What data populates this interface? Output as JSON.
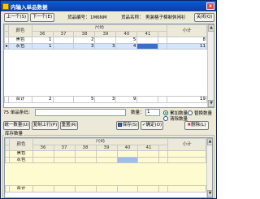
{
  "window": {
    "title": "内输入单品数据",
    "close_label": "x"
  },
  "toolbar": {
    "prev_label": "上一个(S)",
    "next_label": "下一个(E)",
    "product_code_label": "货品编号：",
    "product_code_value": "1M6NM",
    "product_name_label": "货品名称：",
    "product_name_value": "男装格子棉制休闲衫",
    "close_label": "关闭(Q)"
  },
  "top_grid": {
    "header_color": "颜色",
    "header_size_group": "尺码",
    "header_subtotal": "小计",
    "sizes": [
      "36",
      "37",
      "38",
      "39",
      "40",
      "41"
    ],
    "rows": [
      {
        "color": "黑色",
        "values": [
          "1",
          "",
          "2",
          "",
          "5",
          ""
        ],
        "subtotal": "8"
      },
      {
        "color": "灰色",
        "values": [
          "1",
          "",
          "3",
          "3",
          "4",
          ""
        ],
        "subtotal": "11"
      }
    ],
    "total_label": "合计",
    "totals": [
      "2",
      "",
      "5",
      "3",
      "9",
      ""
    ],
    "total_subtotal": "19"
  },
  "input_row": {
    "barcode_label": "75 单品条码：",
    "barcode_value": "",
    "qty_label": "数量：",
    "qty_value": "1",
    "mode_add": "累加数量",
    "mode_replace": "替换数量",
    "mode_clear": "清除数量",
    "mode_selected": "mode_add"
  },
  "actions": {
    "uniform_label": "统一数量(U)",
    "copy_label": "复制上行(P)",
    "reset_label": "重置(R)",
    "save_label": "保存(S)",
    "ok_label": "确定(O)",
    "delete_label": "删除(L)"
  },
  "bottom_group": {
    "title": "库存数量",
    "header_color": "颜色",
    "header_size_group": "尺码",
    "header_subtotal": "小计",
    "sizes": [
      "36",
      "37",
      "38",
      "39",
      "40",
      "41"
    ],
    "rows": [
      {
        "color": "黑色",
        "values": [
          "",
          "",
          "",
          "",
          "",
          ""
        ],
        "subtotal": ""
      },
      {
        "color": "灰色",
        "values": [
          "",
          "",
          "",
          "",
          "",
          ""
        ],
        "subtotal": ""
      }
    ],
    "total_label": "合计"
  }
}
